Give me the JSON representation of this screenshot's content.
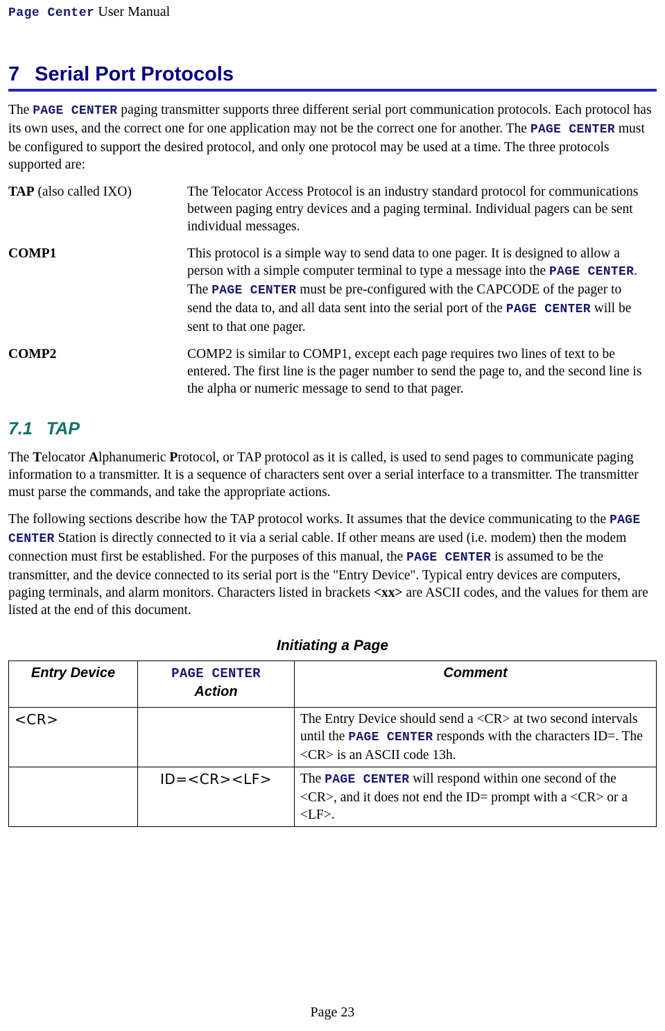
{
  "running_head": {
    "brand": "Page Center",
    "suffix": " User Manual"
  },
  "heading": {
    "number": "7",
    "title": "Serial Port Protocols",
    "rule_color": "#2424c8",
    "text_color": "#000080"
  },
  "intro": {
    "p1_a": "The ",
    "p1_brand1": "PAGE CENTER",
    "p1_b": " paging transmitter supports three different serial port communication protocols.  Each protocol has its own uses, and the correct one for one application may not be the correct one for another.  The ",
    "p1_brand2": "PAGE CENTER",
    "p1_c": " must be configured to support the desired protocol, and only one protocol may be used at a time. The three protocols supported are:"
  },
  "protocols": [
    {
      "term_bold": "TAP",
      "term_rest": " (also called IXO)",
      "desc": "The Telocator Access Protocol is an industry standard protocol for communications between paging entry devices and a paging terminal. Individual pagers can be sent individual messages."
    },
    {
      "term_bold": "COMP1",
      "term_rest": "",
      "desc_a": "This protocol is a simple way to send data to one pager.  It is designed to allow a person with a simple computer terminal to type a message into the ",
      "desc_brand1": "PAGE CENTER",
      "desc_b": ". The ",
      "desc_brand2": "PAGE CENTER",
      "desc_c": " must be pre-configured with the CAPCODE of the pager to send the data to, and all data sent into the serial port of the ",
      "desc_brand3": "PAGE CENTER",
      "desc_d": " will be sent to that one pager."
    },
    {
      "term_bold": "COMP2",
      "term_rest": "",
      "desc": "COMP2 is similar to COMP1, except each page requires two lines of text to be entered. The first line is the pager number to send the page to, and the second line is the alpha or numeric message to send to that pager."
    }
  ],
  "subheading": {
    "number": "7.1",
    "title": "TAP",
    "color": "#0d7268"
  },
  "tap_paragraphs": {
    "p1_a": "The ",
    "p1_t": "T",
    "p1_b": "elocator ",
    "p1_aa": "A",
    "p1_c": "lphanumeric ",
    "p1_p": "P",
    "p1_d": "rotocol, or  TAP protocol as it is called, is used to send pages to communicate paging information to a transmitter.  It is a sequence of characters sent over a serial interface to a transmitter. The transmitter must parse the commands, and take the appropriate actions.",
    "p2_a": "The following sections describe how the TAP protocol works.  It assumes that the device communicating to the ",
    "p2_brand1": "PAGE CENTER",
    "p2_b": " Station is directly connected to it via a serial cable.  If other means are used (i.e. modem) then the modem connection must first be established. For the purposes of this manual, the ",
    "p2_brand2": "PAGE CENTER",
    "p2_c": " is assumed to be the transmitter, and the device connected to its serial port is the \"Entry Device\".  Typical entry devices are computers, paging terminals, and alarm monitors.  Characters listed in brackets ",
    "p2_xx": "<xx>",
    "p2_d": " are ASCII codes, and the values for them are listed at the end of this document."
  },
  "table": {
    "caption": "Initiating a Page",
    "headers": {
      "col1": "Entry Device",
      "col2_brand": "PAGE CENTER",
      "col2_sub": "Action",
      "col3": "Comment"
    },
    "rows": [
      {
        "entry_device": "<CR>",
        "pc_action": "",
        "comment_a": "The Entry Device should send a <CR> at two second intervals until the ",
        "comment_brand": "PAGE CENTER",
        "comment_b": " responds with the characters ID=. The <CR> is an ASCII code 13h."
      },
      {
        "entry_device": "",
        "pc_action": "ID=<CR><LF>",
        "comment_a": "The ",
        "comment_brand": "PAGE CENTER",
        "comment_b": " will respond within one second of the <CR>, and it does not end the ID= prompt with a <CR> or a <LF>."
      }
    ]
  },
  "footer": {
    "page_label": "Page 23"
  }
}
